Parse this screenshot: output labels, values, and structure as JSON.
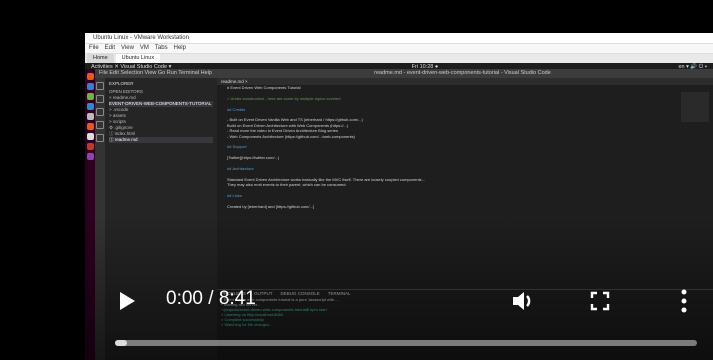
{
  "vm": {
    "title": "Ubuntu Linux - VMware Workstation",
    "menu": [
      "File",
      "Edit",
      "View",
      "VM",
      "Tabs",
      "Help"
    ],
    "tabs": [
      "Home",
      "Ubuntu Linux"
    ]
  },
  "top_panel": {
    "left": "Activities  ✕ Visual Studio Code ▾",
    "center": "Fri 10:28 ●",
    "right": "en ▾  🔊 ⏻ ▾"
  },
  "vscode": {
    "menu": "File  Edit  Selection  View  Go  Run  Terminal  Help",
    "title": "readme.md - event-driven-web-components-tutorial - Visual Studio Code",
    "explorer_header": "EXPLORER",
    "tree": [
      {
        "label": "OPEN EDITORS",
        "selected": false
      },
      {
        "label": "  × readme.md",
        "selected": false
      },
      {
        "label": "EVENT-DRIVEN-WEB-COMPONENTS-TUTORIAL",
        "selected": true
      },
      {
        "label": "  > .vscode",
        "selected": false
      },
      {
        "label": "  > assets",
        "selected": false
      },
      {
        "label": "  > scripts",
        "selected": false
      },
      {
        "label": "  ⚙ .gitignore",
        "selected": false
      },
      {
        "label": "  ⓘ index.html",
        "selected": false
      },
      {
        "label": "  ⓘ readme.md",
        "selected": true
      }
    ],
    "editor_tab": "readme.md ×",
    "lines": [
      {
        "cls": "w",
        "text": "# Event Driven Web Components Tutorial"
      },
      {
        "cls": "w",
        "text": ""
      },
      {
        "cls": "g",
        "text": "> Under construction - here are some by multiple topics covered"
      },
      {
        "cls": "w",
        "text": ""
      },
      {
        "cls": "h",
        "text": "## Credits"
      },
      {
        "cls": "w",
        "text": ""
      },
      {
        "cls": "w",
        "text": "- Built on Event Driven Vanilla Web and TS (ieberhard / https://github.com/...)"
      },
      {
        "cls": "w",
        "text": "  Build on Event Driven Architecture with Web Components (https://...)"
      },
      {
        "cls": "w",
        "text": "- Read more the video in Event Driven Architecture Blog series"
      },
      {
        "cls": "w",
        "text": "- Web Components Architecture (https://github.com/.../web-components)"
      },
      {
        "cls": "w",
        "text": ""
      },
      {
        "cls": "h",
        "text": "## Support"
      },
      {
        "cls": "w",
        "text": ""
      },
      {
        "cls": "w",
        "text": "  [Twitter](https://twitter.com/...)"
      },
      {
        "cls": "w",
        "text": ""
      },
      {
        "cls": "h",
        "text": "## Architecture"
      },
      {
        "cls": "w",
        "text": ""
      },
      {
        "cls": "w",
        "text": "Standard Event Driven Architecture works basically like the MVC itself. There are loosely coupled components..."
      },
      {
        "cls": "w",
        "text": "They may also emit events to their parent, which can be consumed."
      },
      {
        "cls": "w",
        "text": ""
      },
      {
        "cls": "h",
        "text": "## Links"
      },
      {
        "cls": "w",
        "text": ""
      },
      {
        "cls": "w",
        "text": "Created by [ieberhard] and [https://github.com/...]"
      }
    ],
    "panel_tabs": [
      "PROBLEMS",
      "OUTPUT",
      "DEBUG CONSOLE",
      "TERMINAL"
    ],
    "terminal": [
      {
        "cls": "w",
        "text": "* Event driven web components tutorial is a pure Javascript with...."
      },
      {
        "cls": "w",
        "text": "* Starting dev server..."
      },
      {
        "cls": "g",
        "text": "  ~/projects/event-driven-web-components-tutorial$ npm start"
      },
      {
        "cls": "g",
        "text": "  > Listening on http://localhost:8080"
      },
      {
        "cls": "g",
        "text": "  > Compiled successfully"
      },
      {
        "cls": "g",
        "text": "  > Watching for file changes..."
      }
    ]
  },
  "player": {
    "time": "0:00 / 8:41",
    "progress": 0.02
  }
}
